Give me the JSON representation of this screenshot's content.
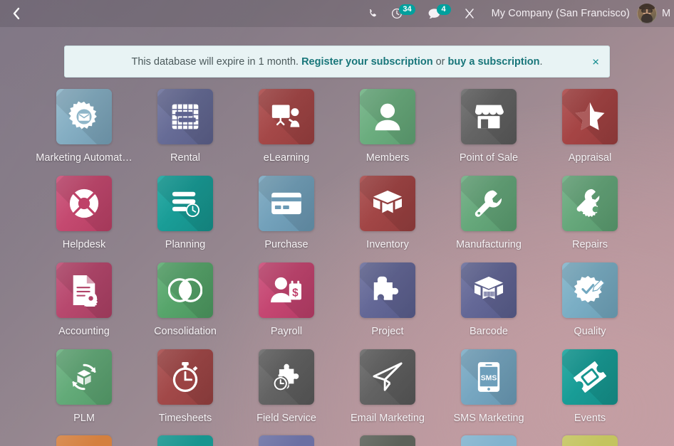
{
  "navbar": {
    "back_icon": "chevron-left-icon",
    "icons": [
      {
        "name": "phone-icon",
        "badge": null
      },
      {
        "name": "activity-clock-icon",
        "badge": "34"
      },
      {
        "name": "messaging-chat-icon",
        "badge": "4"
      },
      {
        "name": "shears-tools-icon",
        "badge": null
      }
    ],
    "company": "My Company (San Francisco)",
    "user_name": "Mit",
    "avatar": "user-avatar"
  },
  "banner": {
    "prefix": "This database will expire in 1 month. ",
    "link1": "Register your subscription",
    "middle": " or ",
    "link2": "buy a subscription",
    "suffix": ".",
    "close_label": "×"
  },
  "apps": [
    {
      "label": "Marketing Automat…",
      "icon": "gear-envelope-icon",
      "color": "#7aa5bc",
      "color2": "#8fb6c9"
    },
    {
      "label": "Rental",
      "icon": "calendar-grid-icon",
      "color": "#5f6490",
      "color2": "#6e739c"
    },
    {
      "label": "eLearning",
      "icon": "whiteboard-presenter-icon",
      "color": "#9e4242",
      "color2": "#ab4d4d"
    },
    {
      "label": "Members",
      "icon": "person-icon",
      "color": "#63a777",
      "color2": "#73b386"
    },
    {
      "label": "Point of Sale",
      "icon": "shop-icon",
      "color": "#5d5d5d",
      "color2": "#6b6b6b"
    },
    {
      "label": "Appraisal",
      "icon": "star-half-icon",
      "color": "#9e3f3f",
      "color2": "#ac4a4a"
    },
    {
      "label": "Helpdesk",
      "icon": "lifebuoy-icon",
      "color": "#bf4268",
      "color2": "#c95077"
    },
    {
      "label": "Planning",
      "icon": "list-clock-icon",
      "color": "#17958f",
      "color2": "#1ba49e"
    },
    {
      "label": "Purchase",
      "icon": "credit-card-icon",
      "color": "#6b9ab5",
      "color2": "#7ba8c0"
    },
    {
      "label": "Inventory",
      "icon": "open-box-icon",
      "color": "#9b4040",
      "color2": "#a84b4b"
    },
    {
      "label": "Manufacturing",
      "icon": "wrench-icon",
      "color": "#5da173",
      "color2": "#6fae83"
    },
    {
      "label": "Repairs",
      "icon": "wrench-gear-icon",
      "color": "#5da173",
      "color2": "#6fae83"
    },
    {
      "label": "Accounting",
      "icon": "document-gear-icon",
      "color": "#b14267",
      "color2": "#bd4e74"
    },
    {
      "label": "Consolidation",
      "icon": "venn-circles-icon",
      "color": "#4f9d63",
      "color2": "#5fad73"
    },
    {
      "label": "Payroll",
      "icon": "person-dollar-icon",
      "color": "#bf3f6b",
      "color2": "#ca4d78"
    },
    {
      "label": "Project",
      "icon": "puzzle-piece-icon",
      "color": "#5c6091",
      "color2": "#6b6f9c"
    },
    {
      "label": "Barcode",
      "icon": "box-barcode-icon",
      "color": "#5c6091",
      "color2": "#6b6f9c"
    },
    {
      "label": "Quality",
      "icon": "badge-pencil-icon",
      "color": "#72a8c0",
      "color2": "#83b4c9"
    },
    {
      "label": "PLM",
      "icon": "cube-refresh-icon",
      "color": "#5aa470",
      "color2": "#6cb181"
    },
    {
      "label": "Timesheets",
      "icon": "stopwatch-icon",
      "color": "#9b4343",
      "color2": "#a84e4e"
    },
    {
      "label": "Field Service",
      "icon": "puzzle-stopwatch-icon",
      "color": "#5c5c5c",
      "color2": "#6a6a6a"
    },
    {
      "label": "Email Marketing",
      "icon": "paper-plane-icon",
      "color": "#5b5b5b",
      "color2": "#696969"
    },
    {
      "label": "SMS Marketing",
      "icon": "phone-sms-icon",
      "color": "#6e9fbb",
      "color2": "#7eadc6"
    },
    {
      "label": "Events",
      "icon": "ticket-icon",
      "color": "#16958f",
      "color2": "#1ba49d"
    }
  ],
  "apps_partial_row": [
    {
      "icon": "partial-tile-orange",
      "color": "#d4803f"
    },
    {
      "icon": "partial-tile-teal",
      "color": "#17958f"
    },
    {
      "icon": "partial-tile-indigo",
      "color": "#6b70a3"
    },
    {
      "icon": "partial-tile-gray",
      "color": "#5c6159"
    },
    {
      "icon": "partial-tile-blue",
      "color": "#82b3ce"
    },
    {
      "icon": "partial-tile-olive",
      "color": "#c3c45f"
    }
  ]
}
